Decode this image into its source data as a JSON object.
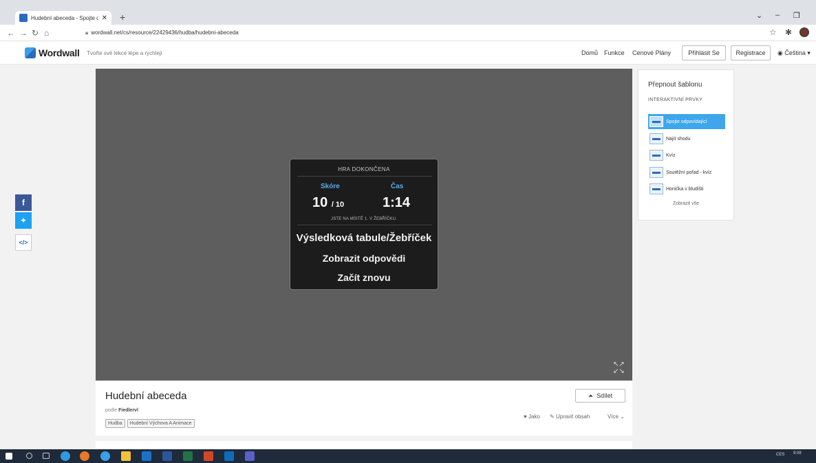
{
  "browser": {
    "tab_title": "Hudební abeceda - Spojte o",
    "url": "wordwall.net/cs/resource/22429436/hudba/hudebni-abeceda"
  },
  "site": {
    "logo": "Wordwall",
    "tagline": "Tvořte své lekce lépe a rychleji",
    "nav": {
      "home": "Domů",
      "features": "Funkce",
      "pricing": "Cenové Plány",
      "login": "Přihlásit Se",
      "register": "Registrace",
      "language": "Čeština"
    }
  },
  "game": {
    "header": "HRA DOKONČENA",
    "score_label": "Skóre",
    "time_label": "Čas",
    "score": "10",
    "score_total": "/ 10",
    "time": "1:14",
    "rank_text": "JSTE NA MÍSTĚ 1. V ŽEBŘÍČKU.",
    "actions": {
      "leaderboard": "Výsledková tabule/Žebříček",
      "answers": "Zobrazit odpovědi",
      "restart": "Začít znovu"
    }
  },
  "resource": {
    "title": "Hudební abeceda",
    "by_prefix": "podle",
    "author": "Fiedlervl",
    "tags": [
      "Hudba",
      "Hudební Výchova A Animace"
    ],
    "share": "Sdílet",
    "like": "Jako",
    "edit": "Upravit obsah",
    "more": "Více"
  },
  "templates": {
    "title": "Přepnout šablonu",
    "subtitle": "INTERAKTIVNÍ PRVKY",
    "items": [
      {
        "label": "Spojte odpovídající",
        "active": true
      },
      {
        "label": "Najít shodu",
        "active": false
      },
      {
        "label": "Kvíz",
        "active": false
      },
      {
        "label": "Soutěžní pořad - kvíz",
        "active": false
      },
      {
        "label": "Honička v bludišti",
        "active": false
      }
    ],
    "show_all": "Zobrazit vše"
  },
  "taskbar": {
    "lang": "CES",
    "time": "9:08"
  },
  "colors": {
    "accent": "#3ea6ea",
    "score_label": "#5aaeea",
    "game_bg": "#5e5e5e",
    "panel_bg": "#1c1c1c"
  }
}
